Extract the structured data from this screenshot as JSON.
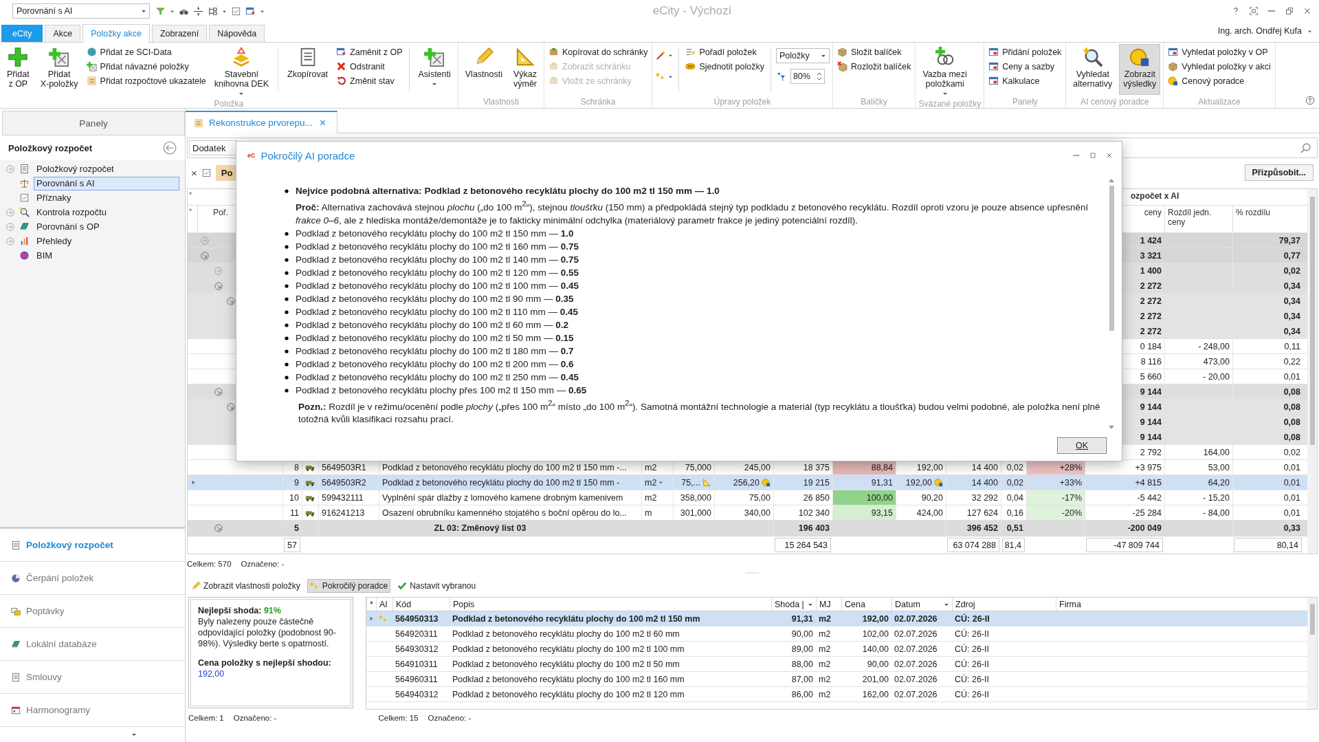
{
  "window": {
    "title": "eCity - Výchozí",
    "quick_combo": "Porovnání s AI",
    "user": "Ing. arch. Ondřej Kufa"
  },
  "ribbon": {
    "tabs": [
      {
        "label": "eCity",
        "kind": "app",
        "selected": false
      },
      {
        "label": "Akce",
        "kind": "tab",
        "selected": false
      },
      {
        "label": "Položky akce",
        "kind": "tab",
        "selected": true
      },
      {
        "label": "Zobrazení",
        "kind": "tab",
        "selected": false
      },
      {
        "label": "Nápověda",
        "kind": "tab",
        "selected": false
      }
    ],
    "groups": [
      {
        "label": "Položka",
        "columns": [
          {
            "kind": "large",
            "lines": [
              "Přidat",
              "z OP"
            ],
            "dropdown": false,
            "pressed": false
          },
          {
            "kind": "large",
            "lines": [
              "Přidat",
              "X-položky"
            ],
            "dropdown": false,
            "pressed": false
          },
          {
            "kind": "stack",
            "items": [
              {
                "label": "Přidat ze SCI-Data",
                "disabled": false
              },
              {
                "label": "Přidat návazné položky",
                "disabled": false
              },
              {
                "label": "Přidat rozpočtové ukazatele",
                "disabled": false
              }
            ]
          },
          {
            "kind": "large",
            "lines": [
              "Stavební",
              "knihovna DEK"
            ],
            "dropdown": true,
            "pressed": false
          },
          {
            "kind": "separator"
          },
          {
            "kind": "large",
            "lines": [
              "Zkopírovat"
            ],
            "dropdown": false,
            "pressed": false
          },
          {
            "kind": "stack",
            "items": [
              {
                "label": "Zaměnit z OP",
                "disabled": false
              },
              {
                "label": "Odstranit",
                "disabled": false
              },
              {
                "label": "Změnit stav",
                "disabled": false
              }
            ]
          },
          {
            "kind": "separator"
          },
          {
            "kind": "large",
            "lines": [
              "Asistenti"
            ],
            "dropdown": true,
            "pressed": false
          }
        ]
      },
      {
        "label": "Vlastnosti",
        "columns": [
          {
            "kind": "large",
            "lines": [
              "Vlastnosti"
            ],
            "dropdown": false,
            "pressed": false
          },
          {
            "kind": "large",
            "lines": [
              "Výkaz",
              "výměr"
            ],
            "dropdown": false,
            "pressed": false
          }
        ]
      },
      {
        "label": "Schránka",
        "columns": [
          {
            "kind": "stack",
            "items": [
              {
                "label": "Kopírovat do schránky",
                "disabled": false
              },
              {
                "label": "Zobrazit schránku",
                "disabled": true
              },
              {
                "label": "Vložit ze schránky",
                "disabled": true
              }
            ]
          }
        ]
      },
      {
        "label": "Úpravy položek",
        "columns": [
          {
            "kind": "tools"
          },
          {
            "kind": "separator"
          },
          {
            "kind": "stack",
            "items": [
              {
                "label": "Pořadí položek",
                "disabled": false
              },
              {
                "label": "Sjednotit položky",
                "disabled": false
              }
            ]
          },
          {
            "kind": "separator"
          },
          {
            "kind": "fields",
            "select": "Položky",
            "spinner": "80%"
          }
        ]
      },
      {
        "label": "Balíčky",
        "columns": [
          {
            "kind": "stack",
            "items": [
              {
                "label": "Složit balíček",
                "disabled": false
              },
              {
                "label": "Rozložit balíček",
                "disabled": false
              }
            ]
          }
        ]
      },
      {
        "label": "Svázané položky",
        "columns": [
          {
            "kind": "large",
            "lines": [
              "Vazba mezi",
              "položkami"
            ],
            "dropdown": true,
            "pressed": false
          }
        ]
      },
      {
        "label": "Panely",
        "columns": [
          {
            "kind": "stack",
            "items": [
              {
                "label": "Přidání položek",
                "disabled": false
              },
              {
                "label": "Ceny a sazby",
                "disabled": false
              },
              {
                "label": "Kalkulace",
                "disabled": false
              }
            ]
          }
        ]
      },
      {
        "label": "AI cenový poradce",
        "columns": [
          {
            "kind": "large",
            "lines": [
              "Vyhledat",
              "alternativy"
            ],
            "dropdown": false,
            "pressed": false
          },
          {
            "kind": "large",
            "lines": [
              "Zobrazit",
              "výsledky"
            ],
            "dropdown": false,
            "pressed": true
          }
        ]
      },
      {
        "label": "Aktualizace",
        "columns": [
          {
            "kind": "stack",
            "items": [
              {
                "label": "Vyhledat položky v OP",
                "disabled": false
              },
              {
                "label": "Vyhledat položky v akci",
                "disabled": false
              },
              {
                "label": "Cenový poradce",
                "disabled": false
              }
            ]
          }
        ]
      }
    ]
  },
  "panels_tab": "Panely",
  "sidebar": {
    "title": "Položkový rozpočet",
    "tree": [
      {
        "label": "Položkový rozpočet",
        "expandable": true,
        "selected": false
      },
      {
        "label": "Porovnání s AI",
        "expandable": false,
        "selected": true
      },
      {
        "label": "Příznaky",
        "expandable": false,
        "selected": false
      },
      {
        "label": "Kontrola rozpočtu",
        "expandable": true,
        "selected": false
      },
      {
        "label": "Porovnání s OP",
        "expandable": true,
        "selected": false
      },
      {
        "label": "Přehledy",
        "expandable": true,
        "selected": false
      },
      {
        "label": "BIM",
        "expandable": false,
        "selected": false
      }
    ],
    "nav": [
      {
        "label": "Položkový rozpočet",
        "selected": true
      },
      {
        "label": "Čerpání položek",
        "selected": false
      },
      {
        "label": "Poptávky",
        "selected": false
      },
      {
        "label": "Lokální databáze",
        "selected": false
      },
      {
        "label": "Smlouvy",
        "selected": false
      },
      {
        "label": "Harmonogramy",
        "selected": false
      }
    ]
  },
  "document_tab": {
    "label": "Rekonstrukce prvorepu...",
    "close": "×"
  },
  "toolbar": {
    "combo": "Dodatek",
    "clear": "×",
    "checked": true,
    "filter_chip": "Po",
    "customize": "Přizpůsobit..."
  },
  "table": {
    "header_markers": [
      "*",
      "*"
    ],
    "group_header": "ozpočet x AI",
    "columns": {
      "order": "Poř.",
      "diff": "ceny",
      "unit_diff": "Rozdíl jedn. ceny",
      "pct_diff": "% rozdílu"
    },
    "rows": [
      {
        "kind": "section",
        "expanded": false,
        "selected": false,
        "diff": "1 424",
        "pct_diff": "79,37"
      },
      {
        "kind": "section",
        "expanded": true,
        "selected": false,
        "diff": "3 321",
        "pct_diff": "0,77"
      },
      {
        "kind": "subsection",
        "expanded": false,
        "selected": false,
        "diff": "1 400",
        "pct_diff": "0,02"
      },
      {
        "kind": "subsection",
        "expanded": true,
        "selected": false,
        "diff": "2 272",
        "pct_diff": "0,34"
      },
      {
        "kind": "part",
        "expanded": true,
        "selected": false,
        "diff": "2 272",
        "pct_diff": "0,34"
      },
      {
        "kind": "summary",
        "selected": false,
        "diff": "2 272",
        "pct_diff": "0,34"
      },
      {
        "kind": "summary",
        "selected": false,
        "diff": "2 272",
        "pct_diff": "0,34"
      },
      {
        "kind": "item",
        "selected": false,
        "diff": "0 184",
        "unit_diff": "- 248,00",
        "pct_diff": "0,11"
      },
      {
        "kind": "item",
        "selected": false,
        "diff": "8 116",
        "unit_diff": "473,00",
        "pct_diff": "0,22"
      },
      {
        "kind": "item",
        "selected": false,
        "diff": "5 660",
        "unit_diff": "- 20,00",
        "pct_diff": "0,01"
      },
      {
        "kind": "subsection",
        "expanded": true,
        "selected": false,
        "diff": "9 144",
        "pct_diff": "0,08"
      },
      {
        "kind": "part",
        "expanded": true,
        "selected": false,
        "diff": "9 144",
        "pct_diff": "0,08"
      },
      {
        "kind": "summary",
        "selected": false,
        "diff": "9 144",
        "pct_diff": "0,08"
      },
      {
        "kind": "summary",
        "selected": false,
        "diff": "9 144",
        "pct_diff": "0,08"
      },
      {
        "kind": "item",
        "selected": false,
        "diff": "2 792",
        "unit_diff": "164,00",
        "pct_diff": "0,02"
      },
      {
        "kind": "item",
        "selected": false,
        "order": "8",
        "code": "5649503R1",
        "desc": "Podklad z betonového recyklátu plochy do 100 m2 tl 150 mm -...",
        "unit": "m2",
        "qty": "75,000",
        "price": "245,00",
        "total": "18 375",
        "ai": {
          "text": "88,84",
          "color": "#e6b8b8"
        },
        "ai_price": "192,00",
        "ai_total": "14 400",
        "share": "0,02",
        "change": {
          "text": "+28%",
          "color": "#efc4c4"
        },
        "diff": "+3 975",
        "unit_diff": "53,00",
        "pct_diff": "0,01"
      },
      {
        "kind": "item",
        "selected": true,
        "order": "9",
        "code": "5649503R2",
        "desc": "Podklad z betonového recyklátu plochy do 100 m2 tl 150 mm -",
        "unit": "m2",
        "qty": "75,...",
        "price": "256,20",
        "total": "19 215",
        "ai": {
          "text": "91,31",
          "color": "#cfe0f5"
        },
        "ai_price": "192,00",
        "ai_total": "14 400",
        "share": "0,02",
        "change": {
          "text": "+33%",
          "color": "#cfe0f5"
        },
        "diff": "+4 815",
        "unit_diff": "64,20",
        "pct_diff": "0,01"
      },
      {
        "kind": "item",
        "selected": false,
        "order": "10",
        "code": "599432111",
        "desc": "Vyplnění spár dlažby z lomového kamene drobným kamenivem",
        "unit": "m2",
        "qty": "358,000",
        "price": "75,00",
        "total": "26 850",
        "ai": {
          "text": "100,00",
          "color": "#8fd48a"
        },
        "ai_price": "90,20",
        "ai_total": "32 292",
        "share": "0,04",
        "change": {
          "text": "-17%",
          "color": "#dff2dc"
        },
        "diff": "-5 442",
        "unit_diff": "- 15,20",
        "pct_diff": "0,01"
      },
      {
        "kind": "item",
        "selected": false,
        "order": "11",
        "code": "916241213",
        "desc": "Osazení obrubníku kamenného stojatého s boční opěrou do lo...",
        "unit": "m",
        "qty": "301,000",
        "price": "340,00",
        "total": "102 340",
        "ai": {
          "text": "93,15",
          "color": "#d3efcf"
        },
        "ai_price": "424,00",
        "ai_total": "127 624",
        "share": "0,16",
        "change": {
          "text": "-20%",
          "color": "#dff2dc"
        },
        "diff": "-25 284",
        "unit_diff": "- 84,00",
        "pct_diff": "0,01"
      },
      {
        "kind": "group",
        "expanded": true,
        "selected": false,
        "order": "5",
        "desc": "ZL 03: Změnový list 03",
        "total": "196 403",
        "ai_total": "396 452",
        "share": "0,51",
        "diff": "-200 049",
        "pct_diff": "0,33"
      }
    ],
    "footer": {
      "count": "57",
      "total": "15 264 543",
      "ai_total": "63 074 288",
      "share": "81,4",
      "diff": "-47 809 744",
      "pct_diff": "80,14"
    },
    "status": {
      "total": "Celkem: 570",
      "marked": "Označeno: -"
    }
  },
  "dialog": {
    "logo": "eC",
    "title": "Pokročilý AI poradce",
    "best": "Nejvíce podobná alternativa: Podklad z betonového recyklátu plochy do 100 m2 tl 150 mm — 1.0",
    "reason": "**Proč:** Alternativa zachovává stejnou *plochu* („do 100 m$^{2}$“), stejnou *tloušťku* (150 mm) a předpokládá stejný typ podkladu z betonového recyklátu. Rozdíl oproti vzoru je pouze absence upřesnění *frakce 0–6*, ale z hlediska montáže/demontáže je to fakticky minimální odchylka (materiálový parametr frakce je jediný potenciální rozdíl).",
    "items": [
      {
        "text": "Podklad z betonového recyklátu plochy do 100 m2 tl 150 mm —",
        "score": "1.0"
      },
      {
        "text": "Podklad z betonového recyklátu plochy do 100 m2 tl 160 mm —",
        "score": "0.75"
      },
      {
        "text": "Podklad z betonového recyklátu plochy do 100 m2 tl 140 mm —",
        "score": "0.75"
      },
      {
        "text": "Podklad z betonového recyklátu plochy do 100 m2 tl 120 mm —",
        "score": "0.55"
      },
      {
        "text": "Podklad z betonového recyklátu plochy do 100 m2 tl 100 mm —",
        "score": "0.45"
      },
      {
        "text": "Podklad z betonového recyklátu plochy do 100 m2 tl 90 mm —",
        "score": "0.35"
      },
      {
        "text": "Podklad z betonového recyklátu plochy do 100 m2 tl 110 mm —",
        "score": "0.45"
      },
      {
        "text": "Podklad z betonového recyklátu plochy do 100 m2 tl 60 mm —",
        "score": "0.2"
      },
      {
        "text": "Podklad z betonového recyklátu plochy do 100 m2 tl 50 mm —",
        "score": "0.15"
      },
      {
        "text": "Podklad z betonového recyklátu plochy do 100 m2 tl 180 mm —",
        "score": "0.7"
      },
      {
        "text": "Podklad z betonového recyklátu plochy do 100 m2 tl 200 mm —",
        "score": "0.6"
      },
      {
        "text": "Podklad z betonového recyklátu plochy do 100 m2 tl 250 mm —",
        "score": "0.45"
      },
      {
        "text": "Podklad z betonového recyklátu plochy přes 100 m2 tl 150 mm —",
        "score": "0.65"
      }
    ],
    "note": "**Pozn.:** Rozdíl je v režimu/ocenění podle *plochy* („přes 100 m$^{2}$“ místo „do 100 m$^{2}$“). Samotná montážní technologie a materiál (typ recyklátu a tloušťka) budou velmi podobné, ale položka není plně totožná kvůli klasifikaci rozsahu prací.",
    "ok": "OK"
  },
  "bottom": {
    "header_marker": "*",
    "tools": [
      {
        "label": "Zobrazit vlastnosti položky",
        "pressed": false
      },
      {
        "label": "Pokročilý poradce",
        "pressed": true
      },
      {
        "label": "Nastavit vybranou",
        "pressed": false
      }
    ],
    "summary": {
      "best_label": "Nejlepší shoda:",
      "best_value": "91%",
      "text": "Byly nalezeny pouze částečně odpovídající položky (podobnost 90-98%). Výsledky berte s opatrností.",
      "price_label": "Cena položky s nejlepší shodou:",
      "price": "192,00"
    },
    "columns": [
      {
        "label": "AI",
        "sort": false
      },
      {
        "label": "Kód",
        "sort": false
      },
      {
        "label": "Popis",
        "sort": false
      },
      {
        "label": "Shoda |",
        "sort": true
      },
      {
        "label": "MJ",
        "sort": false
      },
      {
        "label": "Cena",
        "sort": false
      },
      {
        "label": "Datum",
        "sort": true
      },
      {
        "label": "Zdroj",
        "sort": false
      },
      {
        "label": "Firma",
        "sort": false
      }
    ],
    "rows": [
      {
        "selected": true,
        "code": "564950313",
        "desc": "Podklad z betonového recyklátu plochy do 100 m2 tl 150 mm",
        "match": "91,31",
        "unit": "m2",
        "price": "192,00",
        "date": "02.07.2026",
        "source": "CÚ: 26-II"
      },
      {
        "selected": false,
        "code": "564920311",
        "desc": "Podklad z betonového recyklátu plochy do 100 m2 tl 60 mm",
        "match": "90,00",
        "unit": "m2",
        "price": "102,00",
        "date": "02.07.2026",
        "source": "CÚ: 26-II"
      },
      {
        "selected": false,
        "code": "564930312",
        "desc": "Podklad z betonového recyklátu plochy do 100 m2 tl 100 mm",
        "match": "89,00",
        "unit": "m2",
        "price": "140,00",
        "date": "02.07.2026",
        "source": "CÚ: 26-II"
      },
      {
        "selected": false,
        "code": "564910311",
        "desc": "Podklad z betonového recyklátu plochy do 100 m2 tl 50 mm",
        "match": "88,00",
        "unit": "m2",
        "price": "90,00",
        "date": "02.07.2026",
        "source": "CÚ: 26-II"
      },
      {
        "selected": false,
        "code": "564960311",
        "desc": "Podklad z betonového recyklátu plochy do 100 m2 tl 160 mm",
        "match": "87,00",
        "unit": "m2",
        "price": "201,00",
        "date": "02.07.2026",
        "source": "CÚ: 26-II"
      },
      {
        "selected": false,
        "code": "564940312",
        "desc": "Podklad z betonového recyklátu plochy do 100 m2 tl 120 mm",
        "match": "86,00",
        "unit": "m2",
        "price": "162,00",
        "date": "02.07.2026",
        "source": "CÚ: 26-II"
      }
    ],
    "status_left": {
      "total": "Celkem: 1",
      "marked": "Označeno: -"
    },
    "status_right": {
      "total": "Celkem: 15",
      "marked": "Označeno: -"
    }
  }
}
